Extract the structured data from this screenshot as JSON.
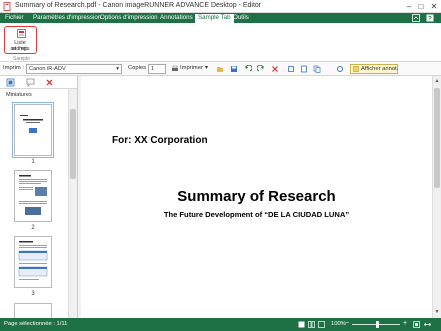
{
  "window": {
    "title": "Summary of Research.pdf - Canon imageRUNNER ADVANCE Desktop - Editor"
  },
  "menu": {
    "items": [
      {
        "label": "Fichier",
        "active": false
      },
      {
        "label": "Paramètres d'impression",
        "active": false
      },
      {
        "label": "Options d'impression",
        "active": false
      },
      {
        "label": "Annotations",
        "active": false
      },
      {
        "label": "Sample Tab",
        "active": true
      },
      {
        "label": "Outils",
        "active": false
      }
    ]
  },
  "ribbon": {
    "button_label_line1": "Liste cachets",
    "button_label_line2": "et img.",
    "group_label": "Sample"
  },
  "toolbar": {
    "printer_label": "Imprim :",
    "printer_value": "Canon iR-ADV",
    "copies_label": "Copies :",
    "copies_value": "1",
    "print_label": "Imprimer",
    "annotations_button": "Afficher annot."
  },
  "thumbnails": {
    "title": "Miniatures",
    "pages": [
      {
        "number": "1",
        "selected": true
      },
      {
        "number": "2",
        "selected": false
      },
      {
        "number": "3",
        "selected": false
      }
    ]
  },
  "document": {
    "for_line": "For: XX Corporation",
    "title": "Summary of Research",
    "subtitle": "The Future Development of “DE LA CIUDAD LUNA”"
  },
  "status": {
    "page_text": "Page sélectionnée : 1/11",
    "zoom": "100%"
  },
  "colors": {
    "accent": "#1e7145",
    "ribbon_highlight": "#e33333"
  }
}
